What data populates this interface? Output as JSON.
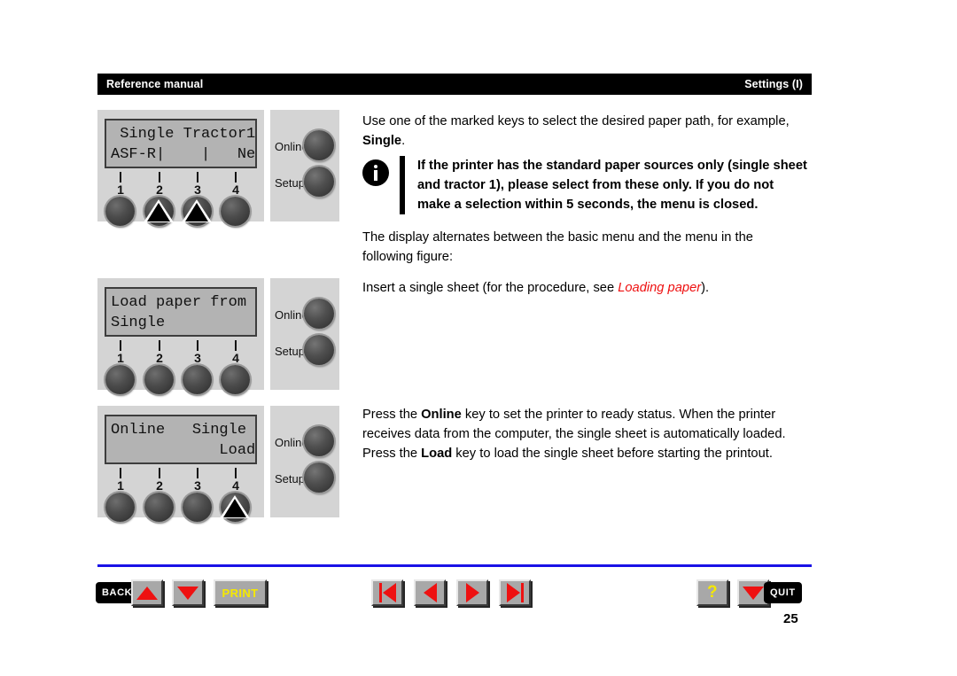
{
  "header": {
    "left_label": "Reference manual",
    "right_label": "Settings (I)"
  },
  "panels": [
    {
      "id": "panel-menu-select",
      "lcd_line1": " Single Tractor1",
      "lcd_line2": "ASF-R|    |   Next",
      "button_numbers": [
        "1",
        "2",
        "3",
        "4"
      ],
      "markers_on": [
        2,
        3
      ],
      "side_buttons": [
        "Online",
        "Setup"
      ]
    },
    {
      "id": "panel-load-paper",
      "lcd_line1": "Load paper from",
      "lcd_line2": "Single",
      "button_numbers": [
        "1",
        "2",
        "3",
        "4"
      ],
      "markers_on": [],
      "side_buttons": [
        "Online",
        "Setup"
      ]
    },
    {
      "id": "panel-online-load",
      "lcd_line1": "Online   Single",
      "lcd_line2": "            Load",
      "button_numbers": [
        "1",
        "2",
        "3",
        "4"
      ],
      "markers_on": [
        4
      ],
      "side_buttons": [
        "Online",
        "Setup"
      ]
    }
  ],
  "content": {
    "para1_a": "Use one of the marked keys to select the desired paper path, for example, ",
    "para1_bold": "Single",
    "para1_b": ".",
    "note": "If the printer has the standard paper sources only (single sheet and tractor 1), please select from these only. If you do not make a selection within 5 seconds, the menu is closed.",
    "para2": "The display alternates between the basic menu and the menu in the following figure:",
    "para3_a": "Insert a single sheet (for the procedure, see ",
    "para3_link": "Loading paper",
    "para3_b": ").",
    "para4_a": "Press the ",
    "para4_bold1": "Online",
    "para4_b": " key to set the printer to ready status. When the printer receives data from the computer, the single sheet is automatically loaded. Press the ",
    "para4_bold2": "Load",
    "para4_c": " key to load the single sheet before starting the printout."
  },
  "nav": {
    "back_label": "BACK",
    "print_label": "PRINT",
    "help_label": "?",
    "quit_label": "QUIT",
    "page_number": "25",
    "icons": {
      "up": "triangle-up-icon",
      "down": "triangle-down-icon",
      "first": "first-page-icon",
      "prev": "previous-page-icon",
      "next": "next-page-icon",
      "last": "last-page-icon"
    }
  },
  "colors": {
    "accent_blue": "#1a12e6",
    "accent_red": "#ee1111",
    "accent_yellow": "#f5e800",
    "panel_gray": "#d4d4d4",
    "lcd_gray": "#b3b3b3"
  }
}
